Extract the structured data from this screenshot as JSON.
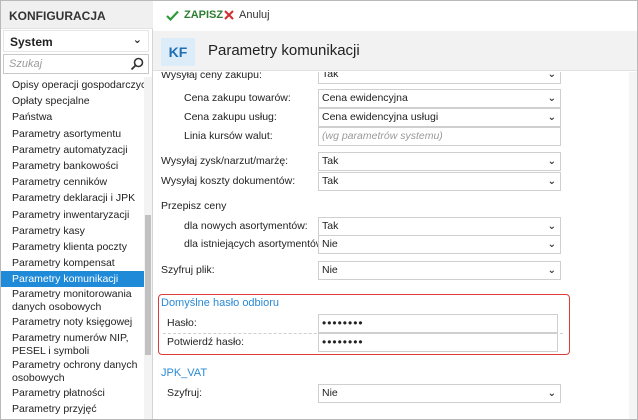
{
  "sidebar": {
    "header": "KONFIGURACJA",
    "module": "System",
    "search_placeholder": "Szukaj",
    "items": [
      {
        "label": "Opisy operacji gospodarczych"
      },
      {
        "label": "Opłaty specjalne"
      },
      {
        "label": "Państwa"
      },
      {
        "label": "Parametry asortymentu"
      },
      {
        "label": "Parametry automatyzacji"
      },
      {
        "label": "Parametry bankowości"
      },
      {
        "label": "Parametry cenników"
      },
      {
        "label": "Parametry deklaracji i JPK"
      },
      {
        "label": "Parametry inwentaryzacji"
      },
      {
        "label": "Parametry kasy"
      },
      {
        "label": "Parametry klienta poczty"
      },
      {
        "label": "Parametry kompensat"
      },
      {
        "label": "Parametry komunikacji"
      },
      {
        "label": "Parametry monitorowania danych osobowych"
      },
      {
        "label": "Parametry noty księgowej"
      },
      {
        "label": "Parametry numerów NIP, PESEL i symboli"
      },
      {
        "label": "Parametry ochrony danych osobowych"
      },
      {
        "label": "Parametry płatności"
      },
      {
        "label": "Parametry przyjęć"
      }
    ]
  },
  "toolbar": {
    "save_label": "ZAPISZ",
    "cancel_label": "Anuluj"
  },
  "page": {
    "badge": "KF",
    "title": "Parametry komunikacji"
  },
  "form": {
    "send_purchase_prices": {
      "label": "Wysyłaj ceny zakupu:",
      "value": "Tak"
    },
    "goods_purchase_price": {
      "label": "Cena zakupu towarów:",
      "value": "Cena ewidencyjna"
    },
    "services_purchase_price": {
      "label": "Cena zakupu usług:",
      "value": "Cena ewidencyjna usługi"
    },
    "fx_rate_line": {
      "label": "Linia kursów walut:",
      "value": "(wg parametrów systemu)"
    },
    "send_profit": {
      "label": "Wysyłaj zysk/narzut/marżę:",
      "value": "Tak"
    },
    "send_doc_costs": {
      "label": "Wysyłaj koszty dokumentów:",
      "value": "Tak"
    },
    "rewrite_prices_title": "Przepisz ceny",
    "new_products": {
      "label": "dla nowych asortymentów:",
      "value": "Tak"
    },
    "existing_products": {
      "label": "dla istniejących asortymentów:",
      "value": "Nie"
    },
    "encrypt_file": {
      "label": "Szyfruj plik:",
      "value": "Nie"
    },
    "default_password_title": "Domyślne hasło odbioru",
    "password": {
      "label": "Hasło:",
      "value": "••••••••"
    },
    "confirm_password": {
      "label": "Potwierdź hasło:",
      "value": "••••••••"
    },
    "jpk_title": "JPK_VAT",
    "jpk_encrypt": {
      "label": "Szyfruj:",
      "value": "Nie"
    }
  },
  "colors": {
    "accent": "#1f8ad8",
    "save": "#2e7d32",
    "cancel": "#d32f2f",
    "highlight": "#e03b3b"
  }
}
